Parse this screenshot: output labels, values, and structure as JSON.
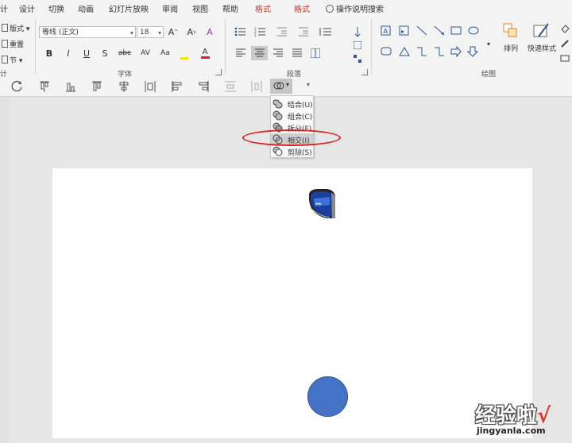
{
  "menu": {
    "items": [
      {
        "label": "计"
      },
      {
        "label": "设计"
      },
      {
        "label": "切换"
      },
      {
        "label": "动画"
      },
      {
        "label": "幻灯片放映"
      },
      {
        "label": "审阅"
      },
      {
        "label": "视图"
      },
      {
        "label": "帮助"
      },
      {
        "label": "格式"
      },
      {
        "label": "格式"
      }
    ],
    "tell_me": "操作说明搜索"
  },
  "ribbon": {
    "slides_group": {
      "layout": "版式",
      "reset": "重置",
      "section": "节",
      "label": "计"
    },
    "font_group": {
      "font_name": "等线 (正文)",
      "font_size": "18",
      "label": "字体",
      "buttons": [
        "B",
        "I",
        "U",
        "S",
        "abc",
        "AV",
        "Aa",
        "A"
      ]
    },
    "paragraph_group": {
      "label": "段落"
    },
    "drawing_group": {
      "label": "绘图",
      "arrange": "排列",
      "quick_styles": "快速样式"
    }
  },
  "merge_menu": {
    "items": [
      {
        "label": "结合(U)"
      },
      {
        "label": "组合(C)"
      },
      {
        "label": "拆分(F)"
      },
      {
        "label": "相交(I)"
      },
      {
        "label": "剪除(S)"
      }
    ],
    "highlighted": "相交(I)"
  },
  "slide": {
    "circle_color": "#4472c4"
  },
  "colors": {
    "accent_red": "#e0201e",
    "tab_red": "#c0392b"
  },
  "watermark": {
    "text": "经验啦",
    "check": "√",
    "url": "jingyanla.com"
  }
}
